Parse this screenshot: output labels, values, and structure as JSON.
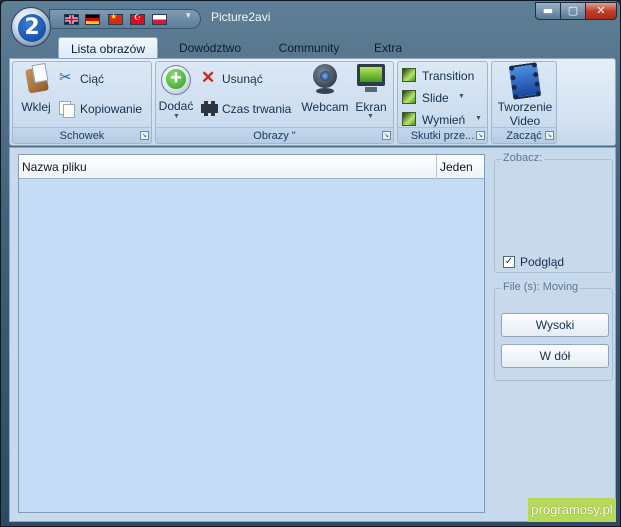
{
  "window": {
    "title": "Picture2avi",
    "logo_text": "2",
    "qat_more": "▾",
    "controls": {
      "minimize": "▬",
      "maximize": "▢",
      "close": "✕"
    },
    "language_flags": [
      "uk-flag",
      "germany-flag",
      "china-flag",
      "turkey-flag",
      "poland-flag"
    ]
  },
  "tabs": [
    {
      "label": "Lista obrazów",
      "active": true
    },
    {
      "label": "Dowództwo",
      "active": false
    },
    {
      "label": "Community",
      "active": false
    },
    {
      "label": "Extra",
      "active": false
    }
  ],
  "ribbon": {
    "schowek": {
      "label": "Schowek",
      "paste": "Wklej",
      "cut": "Ciąć",
      "copy": "Kopiowanie"
    },
    "obrazy": {
      "label": "Obrazy \"",
      "add": "Dodać",
      "remove": "Usunąć",
      "duration": "Czas trwania",
      "webcam": "Webcam",
      "screen": "Ekran"
    },
    "skutki": {
      "label": "Skutki prze...",
      "transition": "Transition",
      "slide": "Slide",
      "replace": "Wymień"
    },
    "zaczac": {
      "label": "Zacząć",
      "create_line1": "Tworzenie",
      "create_line2": "Video"
    }
  },
  "file_list": {
    "columns": [
      "Nazwa pliku",
      "Jeden"
    ]
  },
  "preview": {
    "legend": "Zobacz:",
    "checkbox_label": "Podgląd",
    "checked": true
  },
  "moving": {
    "legend": "File (s): Moving",
    "up": "Wysoki",
    "down": "W dół"
  },
  "watermark": "programosy.pl",
  "colors": {
    "ribbon_bg": "#d3e2f1",
    "list_bg": "#c4dcf6",
    "watermark_bg": "#b7d95a"
  }
}
